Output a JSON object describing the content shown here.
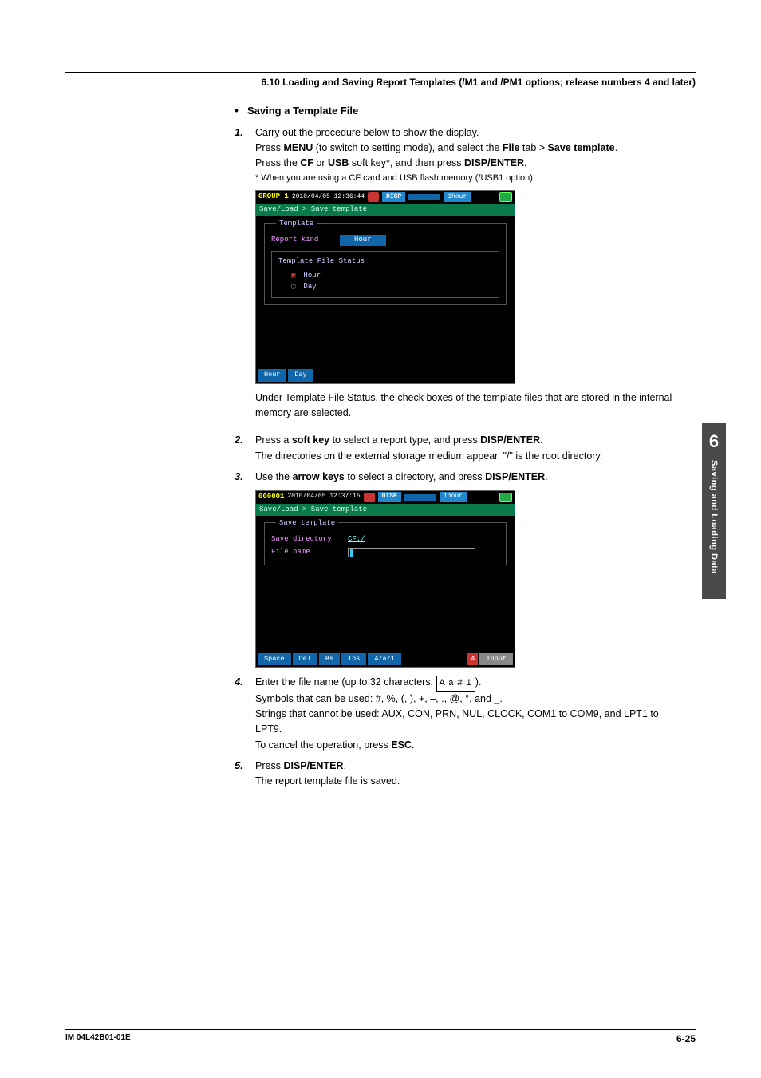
{
  "header": {
    "title": "6.10  Loading and Saving Report Templates (/M1 and /PM1 options; release numbers 4 and later)"
  },
  "bullet": {
    "title": "Saving a Template File"
  },
  "step1": {
    "text": "Carry out the procedure below to show the display.",
    "line1a": "Press ",
    "menu": "MENU",
    "line1b": " (to switch to setting mode), and select the ",
    "file": "File",
    "line1c": " tab > ",
    "save_template": "Save template",
    "line1d": ".",
    "line2a": "Press the ",
    "cf": "CF",
    "line2b": " or ",
    "usb": "USB",
    "line2c": " soft key*, and then press ",
    "dispenter": "DISP/ENTER",
    "line2d": ".",
    "note": "*   When you are using a CF card and USB flash memory (/USB1 option)."
  },
  "ss1": {
    "group": "GROUP 1",
    "dt": "2010/04/05 12:36:44",
    "disp": "DISP",
    "interval": "1hour",
    "path": "Save/Load > Save template",
    "panel_title": "Template",
    "field_label": "Report kind",
    "field_value": "Hour",
    "status_title": "Template File Status",
    "row1_label": "Hour",
    "row2_label": "Day",
    "soft1": "Hour",
    "soft2": "Day"
  },
  "after_ss1": "Under Template File Status, the check boxes of the template files that are stored in the internal memory are selected.",
  "step2": {
    "line1a": "Press a ",
    "softkey": "soft key",
    "line1b": " to select a report type, and press ",
    "dispenter": "DISP/ENTER",
    "line1c": ".",
    "line2": "The directories on the external storage medium appear. \"/\" is the root directory."
  },
  "step3": {
    "line1a": "Use the ",
    "arrow": "arrow keys",
    "line1b": " to select a directory, and press ",
    "dispenter": "DISP/ENTER",
    "line1c": "."
  },
  "ss2": {
    "group": "000001",
    "dt": "2010/04/05 12:37:15",
    "disp": "DISP",
    "interval": "1hour",
    "path": "Save/Load > Save template",
    "panel_title": "Save template",
    "dir_label": "Save directory",
    "dir_value": "CF:/",
    "file_label": "File name",
    "soft": [
      "Space",
      "Del",
      "Bs",
      "Ins",
      "A/a/1"
    ],
    "soft_r1": "A",
    "soft_r2": "Input"
  },
  "step4": {
    "line1a": "Enter the file name (up to 32 characters, ",
    "kbd": "A a # 1",
    "line1b": ").",
    "sym": "Symbols that can be used: #, %, (, ), +, –, ., @, °, and _.",
    "str": "Strings that cannot be used: AUX, CON, PRN, NUL, CLOCK, COM1 to COM9, and LPT1 to LPT9.",
    "cancel_a": "To cancel the operation, press ",
    "esc": "ESC",
    "cancel_b": "."
  },
  "step5": {
    "line1a": "Press ",
    "dispenter": "DISP/ENTER",
    "line1b": ".",
    "line2": "The report template file is saved."
  },
  "sidebar": {
    "chapter": "6",
    "title": "Saving and Loading Data"
  },
  "footer": {
    "doc": "IM 04L42B01-01E",
    "page": "6-25"
  }
}
